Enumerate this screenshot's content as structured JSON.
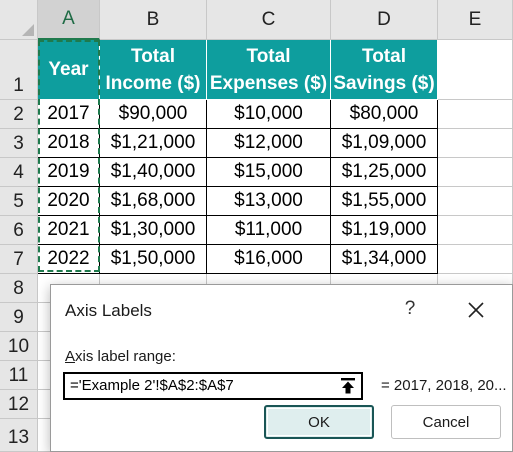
{
  "sheet": {
    "columns": [
      "A",
      "B",
      "C",
      "D",
      "E"
    ],
    "rows": [
      "1",
      "2",
      "3",
      "4",
      "5",
      "6",
      "7",
      "8",
      "9",
      "10",
      "11",
      "12",
      "13"
    ],
    "table": {
      "headers": [
        [
          "Year"
        ],
        [
          "Total",
          "Income ($)"
        ],
        [
          "Total",
          "Expenses ($)"
        ],
        [
          "Total",
          "Savings ($)"
        ]
      ],
      "data": [
        [
          "2017",
          "$90,000",
          "$10,000",
          "$80,000"
        ],
        [
          "2018",
          "$1,21,000",
          "$12,000",
          "$1,09,000"
        ],
        [
          "2019",
          "$1,40,000",
          "$15,000",
          "$1,25,000"
        ],
        [
          "2020",
          "$1,68,000",
          "$13,000",
          "$1,55,000"
        ],
        [
          "2021",
          "$1,30,000",
          "$11,000",
          "$1,19,000"
        ],
        [
          "2022",
          "$1,50,000",
          "$16,000",
          "$1,34,000"
        ]
      ]
    },
    "header_color": "#0e9e9e",
    "selected_column": "A"
  },
  "dialog": {
    "title": "Axis Labels",
    "help": "?",
    "range_label_accel": "A",
    "range_label_rest": "xis label range:",
    "range_value": "='Example 2'!$A$2:$A$7",
    "preview": "= 2017, 2018, 20...",
    "ok_label": "OK",
    "cancel_label": "Cancel",
    "icons": {
      "close": "close-icon",
      "collapse": "collapse-dialog-icon"
    }
  }
}
